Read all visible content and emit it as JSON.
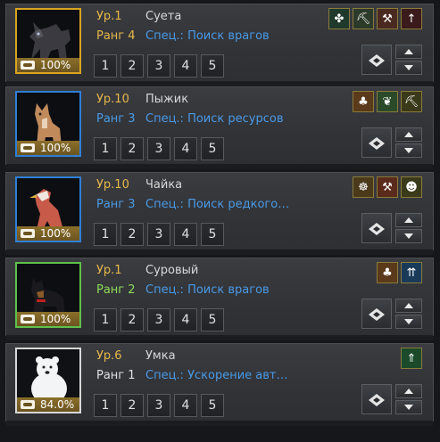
{
  "colors": {
    "level": "#e8b84a",
    "rank_gold": "#e8b84a",
    "rank_blue": "#4a9ae6",
    "rank_green": "#8fdc5a",
    "rank_white": "#e0e0e0",
    "spec": "#4a9ae6"
  },
  "slot_labels": [
    "1",
    "2",
    "3",
    "4",
    "5"
  ],
  "pets": [
    {
      "level": "Ур.1",
      "name": "Суета",
      "rank": "Ранг 4",
      "spec": "Спец.: Поиск врагов",
      "stamina": "100%",
      "skills": [
        "clover-icon",
        "pickaxe-icon",
        "axe-icon",
        "arrow-icon"
      ]
    },
    {
      "level": "Ур.10",
      "name": "Пыжик",
      "rank": "Ранг 3",
      "spec": "Спец.: Поиск ресурсов",
      "stamina": "100%",
      "skills": [
        "tree-icon",
        "feather-icon",
        "pickaxe-icon"
      ]
    },
    {
      "level": "Ур.10",
      "name": "Чайка",
      "rank": "Ранг 3",
      "spec": "Спец.: Поиск редкого…",
      "stamina": "100%",
      "skills": [
        "cart-icon",
        "hammer-icon",
        "head-icon"
      ]
    },
    {
      "level": "Ур.1",
      "name": "Суровый",
      "rank": "Ранг 2",
      "spec": "Спец.: Поиск врагов",
      "stamina": "100%",
      "skills": [
        "tree-icon",
        "arrows-icon"
      ]
    },
    {
      "level": "Ур.6",
      "name": "Умка",
      "rank": "Ранг 1",
      "spec": "Спец.: Ускорение авт…",
      "stamina": "84.0%",
      "skills": [
        "person-arrow-icon"
      ]
    }
  ]
}
